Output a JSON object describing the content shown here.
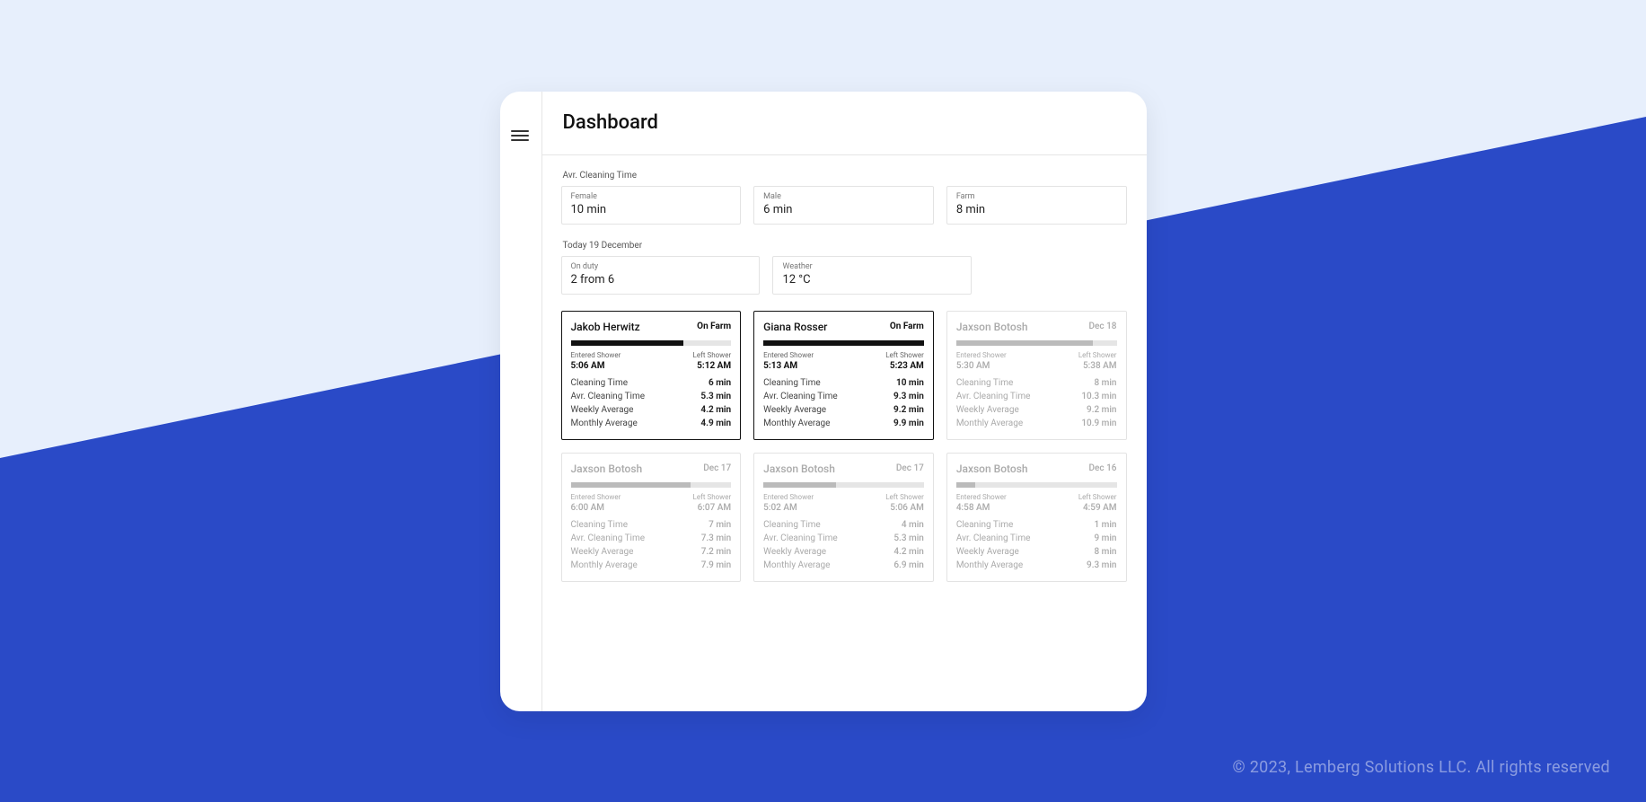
{
  "footer": "© 2023, Lemberg Solutions LLC. All rights reserved",
  "header": {
    "title": "Dashboard"
  },
  "avg_section": {
    "label": "Avr. Cleaning Time",
    "cards": [
      {
        "label": "Female",
        "value": "10 min"
      },
      {
        "label": "Male",
        "value": "6 min"
      },
      {
        "label": "Farm",
        "value": "8 min"
      }
    ]
  },
  "today_section": {
    "label": "Today 19 December",
    "cards": [
      {
        "label": "On duty",
        "value": "2 from 6"
      },
      {
        "label": "Weather",
        "value": "12 °C"
      }
    ]
  },
  "labels": {
    "entered": "Entered Shower",
    "left": "Left Shower",
    "cleaning_time": "Cleaning Time",
    "avg_cleaning": "Avr. Cleaning Time",
    "weekly": "Weekly Average",
    "monthly": "Monthly Average"
  },
  "people": [
    {
      "name": "Jakob Herwitz",
      "badge": "On Farm",
      "active": true,
      "bar_pct": 70,
      "entered": "5:06 AM",
      "left": "5:12 AM",
      "metrics": {
        "cleaning": "6 min",
        "avg": "5.3 min",
        "weekly": "4.2 min",
        "monthly": "4.9 min"
      }
    },
    {
      "name": "Giana Rosser",
      "badge": "On Farm",
      "active": true,
      "bar_pct": 100,
      "entered": "5:13 AM",
      "left": "5:23 AM",
      "metrics": {
        "cleaning": "10 min",
        "avg": "9.3 min",
        "weekly": "9.2 min",
        "monthly": "9.9 min"
      }
    },
    {
      "name": "Jaxson Botosh",
      "badge": "Dec 18",
      "active": false,
      "bar_pct": 85,
      "entered": "5:30 AM",
      "left": "5:38 AM",
      "metrics": {
        "cleaning": "8 min",
        "avg": "10.3 min",
        "weekly": "9.2 min",
        "monthly": "10.9 min"
      }
    },
    {
      "name": "Jaxson Botosh",
      "badge": "Dec 17",
      "active": false,
      "bar_pct": 75,
      "entered": "6:00 AM",
      "left": "6:07 AM",
      "metrics": {
        "cleaning": "7 min",
        "avg": "7.3 min",
        "weekly": "7.2 min",
        "monthly": "7.9 min"
      }
    },
    {
      "name": "Jaxson Botosh",
      "badge": "Dec 17",
      "active": false,
      "bar_pct": 45,
      "entered": "5:02 AM",
      "left": "5:06 AM",
      "metrics": {
        "cleaning": "4 min",
        "avg": "5.3 min",
        "weekly": "4.2 min",
        "monthly": "6.9 min"
      }
    },
    {
      "name": "Jaxson Botosh",
      "badge": "Dec 16",
      "active": false,
      "bar_pct": 12,
      "entered": "4:58 AM",
      "left": "4:59 AM",
      "metrics": {
        "cleaning": "1 min",
        "avg": "9 min",
        "weekly": "8 min",
        "monthly": "9.3 min"
      }
    }
  ]
}
